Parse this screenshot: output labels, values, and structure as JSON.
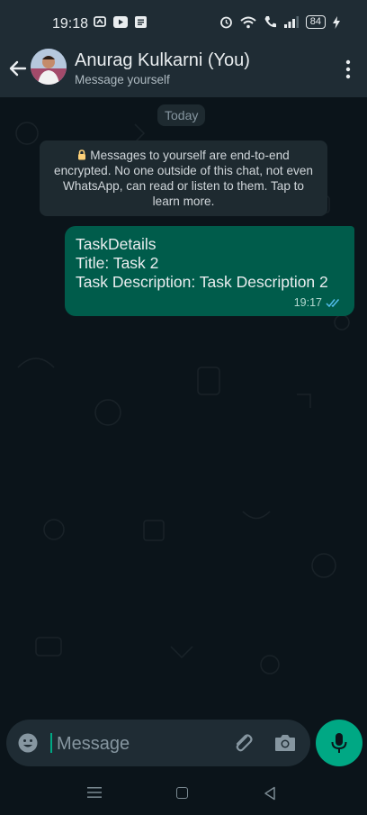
{
  "status_bar": {
    "time": "19:18",
    "battery": "84"
  },
  "header": {
    "contact_name": "Anurag Kulkarni (You)",
    "subtitle": "Message yourself"
  },
  "chat": {
    "date_divider": "Today",
    "encryption_notice": "Messages to yourself are end-to-end encrypted. No one outside of this chat, not even WhatsApp, can read or listen to them. Tap to learn more.",
    "messages": [
      {
        "lines": [
          "TaskDetails",
          "Title: Task 2",
          "Task Description: Task Description 2"
        ],
        "time": "19:17",
        "status": "read"
      }
    ]
  },
  "composer": {
    "placeholder": "Message"
  },
  "colors": {
    "accent": "#00a884",
    "outgoing_bubble": "#005c4b",
    "header_bg": "#1f2c34",
    "chat_bg": "#0b141a"
  },
  "icons": [
    "back-arrow-icon",
    "more-vert-icon",
    "lock-icon",
    "double-check-icon",
    "emoji-icon",
    "attach-icon",
    "camera-icon",
    "mic-icon"
  ]
}
